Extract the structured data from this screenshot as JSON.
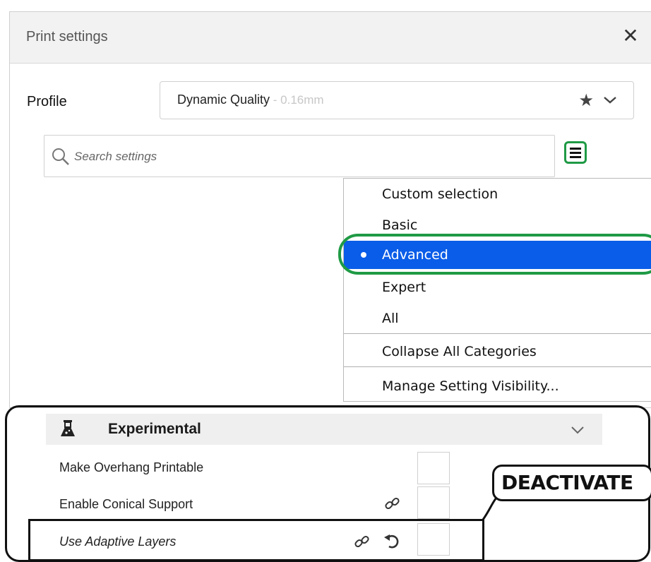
{
  "window": {
    "title": "Print settings",
    "close_symbol": "✕"
  },
  "profile": {
    "label": "Profile",
    "name": "Dynamic Quality",
    "layer_height": " - 0.16mm",
    "star_icon": "★"
  },
  "search": {
    "placeholder": "Search settings",
    "value": ""
  },
  "visibility_menu": {
    "items": [
      {
        "label": "Custom selection"
      },
      {
        "label": "Basic"
      },
      {
        "label": "Advanced",
        "selected": true
      },
      {
        "label": "Expert"
      },
      {
        "label": "All"
      },
      {
        "label": "Collapse All Categories"
      },
      {
        "label": "Manage Setting Visibility..."
      }
    ],
    "selected_color": "#0a5de8",
    "highlight_color": "#1f9a45"
  },
  "category": {
    "label": "Experimental"
  },
  "settings": [
    {
      "label": "Make Overhang Printable",
      "checked": false
    },
    {
      "label": "Enable Conical Support",
      "checked": false
    },
    {
      "label": "Use Adaptive Layers",
      "checked": false
    }
  ],
  "annotation": {
    "text": "DEACTIVATE"
  }
}
